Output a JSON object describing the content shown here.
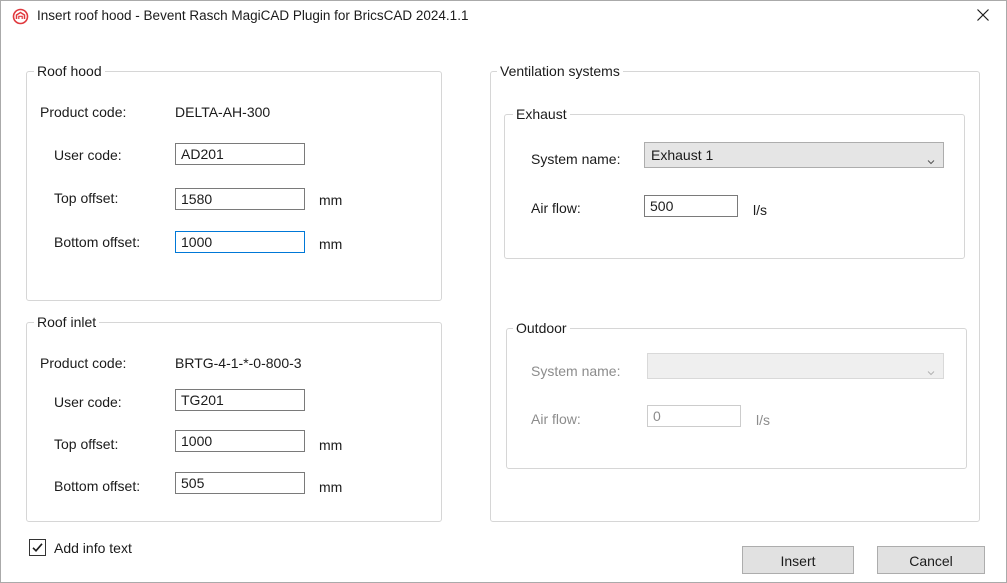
{
  "window": {
    "title": "Insert roof hood - Bevent Rasch MagiCAD Plugin for BricsCAD 2024.1.1",
    "close_glyph": "✕"
  },
  "roof_hood": {
    "group_label": "Roof hood",
    "product_code_label": "Product code:",
    "product_code_value": "DELTA-AH-300",
    "user_code_label": "User code:",
    "user_code_value": "AD201",
    "top_offset_label": "Top offset:",
    "top_offset_value": "1580",
    "top_offset_unit": "mm",
    "bottom_offset_label": "Bottom offset:",
    "bottom_offset_value": "1000",
    "bottom_offset_unit": "mm"
  },
  "roof_inlet": {
    "group_label": "Roof inlet",
    "product_code_label": "Product code:",
    "product_code_value": "BRTG-4-1-*-0-800-3",
    "user_code_label": "User code:",
    "user_code_value": "TG201",
    "top_offset_label": "Top offset:",
    "top_offset_value": "1000",
    "top_offset_unit": "mm",
    "bottom_offset_label": "Bottom offset:",
    "bottom_offset_value": "505",
    "bottom_offset_unit": "mm"
  },
  "ventilation": {
    "group_label": "Ventilation systems",
    "exhaust": {
      "group_label": "Exhaust",
      "system_name_label": "System name:",
      "system_name_value": "Exhaust 1",
      "air_flow_label": "Air flow:",
      "air_flow_value": "500",
      "air_flow_unit": "l/s"
    },
    "outdoor": {
      "group_label": "Outdoor",
      "system_name_label": "System name:",
      "system_name_value": "",
      "air_flow_label": "Air flow:",
      "air_flow_value": "0",
      "air_flow_unit": "l/s"
    }
  },
  "add_info_text": {
    "label": "Add info text",
    "checked": true
  },
  "buttons": {
    "insert": "Insert",
    "cancel": "Cancel"
  },
  "icons": {
    "app": "magicad-logo-icon",
    "close": "close-icon",
    "dropdown": "chevron-down-icon",
    "check": "checkmark-icon"
  },
  "colors": {
    "accent": "#0078d7",
    "logo": "#e0393e"
  }
}
